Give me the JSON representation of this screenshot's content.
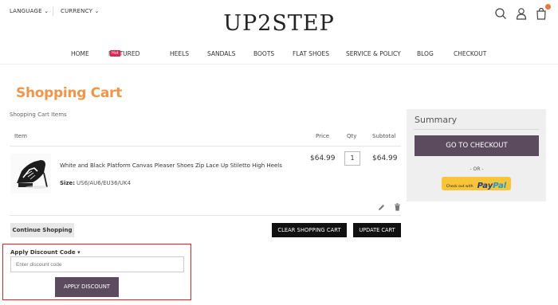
{
  "header": {
    "language_label": "LANGUAGE",
    "currency_label": "CURRENCY",
    "logo": "UP2STEP"
  },
  "nav": {
    "items": [
      "HOME",
      "FEATURED",
      "HEELS",
      "SANDALS",
      "BOOTS",
      "FLAT SHOES",
      "SERVICE & POLICY",
      "BLOG",
      "CHECKOUT"
    ],
    "featured_badge": "Hot"
  },
  "page": {
    "title": "Shopping Cart",
    "items_label": "Shopping Cart Items"
  },
  "table": {
    "headers": [
      "Item",
      "Price",
      "Qty",
      "Subtotal"
    ],
    "rows": [
      {
        "name": "White and Black Platform Canvas Pleaser Shoes Zip Lace Up Stiletto High Heels",
        "size_label": "Size:",
        "size_value": "US6/AU6/EU36/UK4",
        "price": "$64.99",
        "qty": "1",
        "subtotal": "$64.99"
      }
    ]
  },
  "actions": {
    "continue": "Continue Shopping",
    "clear": "CLEAR SHOPPING CART",
    "update": "UPDATE CART"
  },
  "discount": {
    "title": "Apply Discount Code",
    "placeholder": "Enter discount code",
    "apply": "APPLY DISCOUNT"
  },
  "summary": {
    "title": "Summary",
    "checkout": "GO TO CHECKOUT",
    "or": "- OR -",
    "paypal_small": "Check out with",
    "paypal_brand_1": "Pay",
    "paypal_brand_2": "Pal"
  },
  "colors": {
    "accent": "#f0954a",
    "primary_button": "#5c4a5f",
    "highlight_frame": "#e0202a",
    "badge": "#d8264f"
  },
  "icons": [
    "chevron-down-icon",
    "search-icon",
    "user-icon",
    "cart-icon",
    "edit-icon",
    "trash-icon"
  ]
}
